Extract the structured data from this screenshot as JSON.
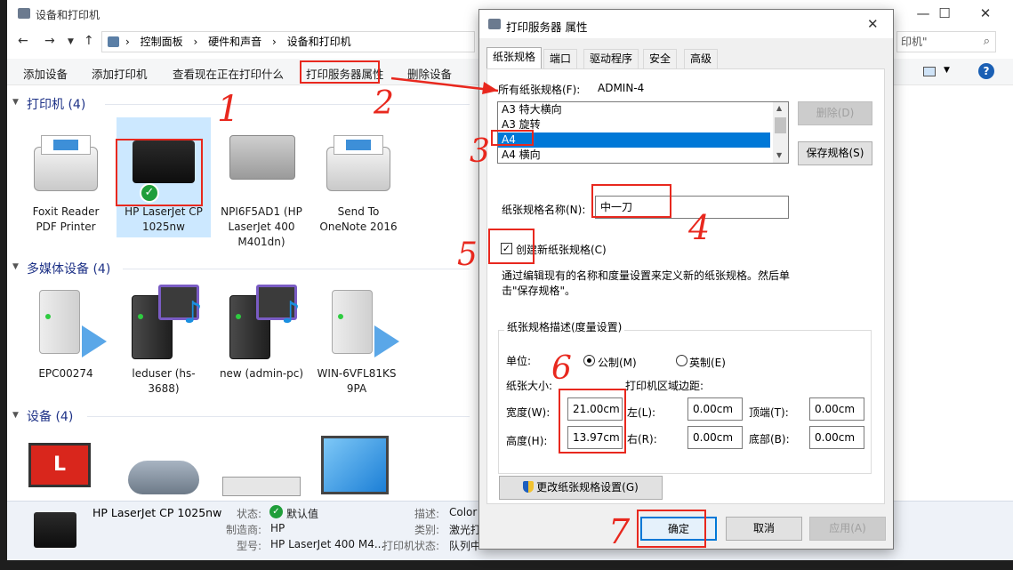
{
  "explorer": {
    "title": "设备和打印机",
    "window_controls": {
      "minimize": "—",
      "maximize": "☐",
      "close": "✕"
    },
    "breadcrumb": [
      "控制面板",
      "硬件和声音",
      "设备和打印机"
    ],
    "breadcrumb_sep": "›",
    "search_placeholder": "印机\"",
    "commands": [
      "添加设备",
      "添加打印机",
      "查看现在正在打印什么",
      "打印服务器属性",
      "删除设备"
    ],
    "sections": {
      "printers": {
        "heading": "打印机 (4)",
        "items": [
          {
            "label": "Foxit Reader PDF Printer"
          },
          {
            "label": "HP LaserJet CP 1025nw"
          },
          {
            "label": "NPI6F5AD1 (HP LaserJet 400 M401dn)"
          },
          {
            "label": "Send To OneNote 2016"
          }
        ]
      },
      "multimedia": {
        "heading": "多媒体设备 (4)",
        "items": [
          {
            "label": "EPC00274"
          },
          {
            "label": "leduser (hs-3688)"
          },
          {
            "label": "new (admin-pc)"
          },
          {
            "label": "WIN-6VFL81KS 9PA"
          }
        ]
      },
      "devices": {
        "heading": "设备 (4)"
      }
    },
    "details": {
      "device_name": "HP LaserJet CP 1025nw",
      "rows": [
        {
          "label": "状态:",
          "value": "默认值"
        },
        {
          "label": "制造商:",
          "value": "HP"
        },
        {
          "label": "型号:",
          "value": "HP LaserJet 400 M4..."
        }
      ],
      "rows2": [
        {
          "label": "描述:",
          "value": "Color"
        },
        {
          "label": "类别:",
          "value": "激光打"
        },
        {
          "label": "打印机状态:",
          "value": "队列中"
        }
      ]
    },
    "help_icon_text": "?"
  },
  "dialog": {
    "title": "打印服务器 属性",
    "close": "✕",
    "tabs": [
      "纸张规格",
      "端口",
      "驱动程序",
      "安全",
      "高级"
    ],
    "all_forms_label": "所有纸张规格(F):",
    "server_name": "ADMIN-4",
    "forms": [
      "A3 特大横向",
      "A3 旋转",
      "A4",
      "A4 横向"
    ],
    "selected_form_index": 2,
    "delete_button": "删除(D)",
    "save_button": "保存规格(S)",
    "form_name_label": "纸张规格名称(N):",
    "form_name_value": "中一刀",
    "create_new_label": "创建新纸张规格(C)",
    "create_new_checked": true,
    "hint_text": "通过编辑现有的名称和度量设置来定义新的纸张规格。然后单击\"保存规格\"。",
    "measure_group_label": "纸张规格描述(度量设置)",
    "unit_label": "单位:",
    "metric_label": "公制(M)",
    "english_label": "英制(E)",
    "paper_size_label": "纸张大小:",
    "margins_label": "打印机区域边距:",
    "width_label": "宽度(W):",
    "width_value": "21.00cm",
    "height_label": "高度(H):",
    "height_value": "13.97cm",
    "left_label": "左(L):",
    "left_value": "0.00cm",
    "right_label": "右(R):",
    "right_value": "0.00cm",
    "top_label": "顶端(T):",
    "top_value": "0.00cm",
    "bottom_label": "底部(B):",
    "bottom_value": "0.00cm",
    "change_settings_button": "更改纸张规格设置(G)",
    "ok_button": "确定",
    "cancel_button": "取消",
    "apply_button": "应用(A)"
  },
  "annotations": {
    "n1": "1",
    "n2": "2",
    "n3": "3",
    "n4": "4",
    "n5": "5",
    "n6": "6",
    "n7": "7"
  },
  "colors": {
    "annotation_red": "#e8281e",
    "selection_blue": "#0078d7",
    "section_heading": "#1e3287"
  }
}
